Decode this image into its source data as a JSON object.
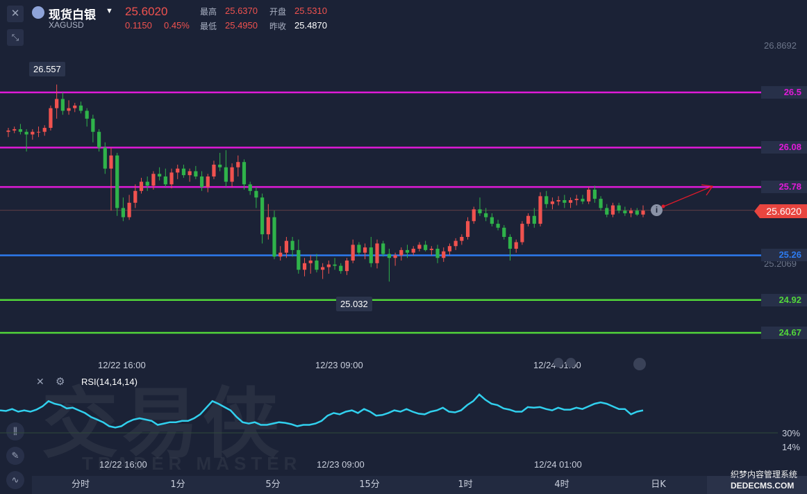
{
  "header": {
    "close_icon": "close-icon",
    "collapse_icon": "collapse-icon",
    "instrument_name": "现货白银",
    "symbol": "XAGUSD",
    "last_price": "25.6020",
    "change": "0.1150",
    "change_pct": "0.45%",
    "high_label": "最高",
    "high_value": "25.6370",
    "open_label": "开盘",
    "open_value": "25.5310",
    "low_label": "最低",
    "low_value": "25.4950",
    "prev_close_label": "昨收",
    "prev_close_value": "25.4870"
  },
  "colors": {
    "up": "#f0524f",
    "down": "#2fb34a",
    "magenta_level": "#e01ad8",
    "blue_level": "#2d7bf0",
    "green_level": "#52d63a",
    "rsi_line": "#31d0ee"
  },
  "price_axis": {
    "top_label": "26.8692",
    "mid_label": "25.2069",
    "current_price_tag": "25.6020"
  },
  "callouts": {
    "high": "26.557",
    "low": "25.032"
  },
  "levels": [
    {
      "value": 26.5,
      "label": "26.5",
      "color": "#e01ad8"
    },
    {
      "value": 26.08,
      "label": "26.08",
      "color": "#e01ad8"
    },
    {
      "value": 25.78,
      "label": "25.78",
      "color": "#e01ad8"
    },
    {
      "value": 25.26,
      "label": "25.26",
      "color": "#2d7bf0"
    },
    {
      "value": 24.92,
      "label": "24.92",
      "color": "#52d63a"
    },
    {
      "value": 24.67,
      "label": "24.67",
      "color": "#52d63a"
    }
  ],
  "time_labels": [
    "12/22 16:00",
    "12/23 09:00",
    "12/24 01:00"
  ],
  "rsi": {
    "label": "RSI(14,14,14)",
    "level_high": "30%",
    "level_low": "14%"
  },
  "tabs": [
    "分时",
    "1分",
    "5分",
    "15分",
    "1时",
    "4时",
    "日K"
  ],
  "watermark": {
    "logo": "交易侠",
    "brand": "TRADER MASTER",
    "corner": "织梦内容管理系统",
    "corner_url": "DEDECMS.COM"
  },
  "chart_data": {
    "type": "candlestick",
    "title": "现货白银 XAGUSD",
    "ylim": [
      24.45,
      26.95
    ],
    "x_ticks": [
      "12/22 16:00",
      "12/23 09:00",
      "12/24 01:00"
    ],
    "candles": [
      [
        26.2,
        26.23,
        26.16,
        26.21
      ],
      [
        26.21,
        26.24,
        26.19,
        26.22
      ],
      [
        26.22,
        26.26,
        26.18,
        26.2
      ],
      [
        26.2,
        26.22,
        26.05,
        26.18
      ],
      [
        26.18,
        26.22,
        26.14,
        26.2
      ],
      [
        26.2,
        26.24,
        26.16,
        26.2
      ],
      [
        26.2,
        26.25,
        26.17,
        26.23
      ],
      [
        26.23,
        26.4,
        26.21,
        26.38
      ],
      [
        26.38,
        26.56,
        26.3,
        26.45
      ],
      [
        26.45,
        26.5,
        26.33,
        26.36
      ],
      [
        26.36,
        26.44,
        26.33,
        26.38
      ],
      [
        26.38,
        26.42,
        26.35,
        26.4
      ],
      [
        26.4,
        26.43,
        26.34,
        26.36
      ],
      [
        26.36,
        26.38,
        26.24,
        26.3
      ],
      [
        26.3,
        26.33,
        26.12,
        26.2
      ],
      [
        26.2,
        26.22,
        26.05,
        26.08
      ],
      [
        26.08,
        26.12,
        25.88,
        25.92
      ],
      [
        25.92,
        26.08,
        25.6,
        26.02
      ],
      [
        26.02,
        26.04,
        25.56,
        25.62
      ],
      [
        25.62,
        25.7,
        25.52,
        25.55
      ],
      [
        25.55,
        25.72,
        25.53,
        25.66
      ],
      [
        25.66,
        25.8,
        25.62,
        25.75
      ],
      [
        25.75,
        25.85,
        25.73,
        25.82
      ],
      [
        25.82,
        25.86,
        25.75,
        25.79
      ],
      [
        25.79,
        25.9,
        25.76,
        25.88
      ],
      [
        25.88,
        25.93,
        25.83,
        25.86
      ],
      [
        25.86,
        25.92,
        25.78,
        25.8
      ],
      [
        25.8,
        25.92,
        25.77,
        25.89
      ],
      [
        25.89,
        25.95,
        25.84,
        25.92
      ],
      [
        25.92,
        25.95,
        25.85,
        25.87
      ],
      [
        25.87,
        25.92,
        25.82,
        25.9
      ],
      [
        25.9,
        25.94,
        25.84,
        25.86
      ],
      [
        25.86,
        25.9,
        25.75,
        25.78
      ],
      [
        25.78,
        25.88,
        25.74,
        25.86
      ],
      [
        25.86,
        25.98,
        25.84,
        25.95
      ],
      [
        25.95,
        26.04,
        25.9,
        25.93
      ],
      [
        25.93,
        26.06,
        25.78,
        25.82
      ],
      [
        25.82,
        25.96,
        25.78,
        25.93
      ],
      [
        25.93,
        26.02,
        25.86,
        25.97
      ],
      [
        25.97,
        25.99,
        25.76,
        25.8
      ],
      [
        25.8,
        25.82,
        25.72,
        25.75
      ],
      [
        25.75,
        25.78,
        25.62,
        25.7
      ],
      [
        25.7,
        25.73,
        25.35,
        25.42
      ],
      [
        25.42,
        25.65,
        25.38,
        25.55
      ],
      [
        25.55,
        25.6,
        25.23,
        25.25
      ],
      [
        25.25,
        25.33,
        25.22,
        25.28
      ],
      [
        25.28,
        25.4,
        25.24,
        25.37
      ],
      [
        25.37,
        25.4,
        25.25,
        25.3
      ],
      [
        25.3,
        25.38,
        25.12,
        25.15
      ],
      [
        25.15,
        25.24,
        25.1,
        25.2
      ],
      [
        25.2,
        25.26,
        25.12,
        25.22
      ],
      [
        25.22,
        25.27,
        25.13,
        25.15
      ],
      [
        25.15,
        25.2,
        25.08,
        25.17
      ],
      [
        25.17,
        25.22,
        25.12,
        25.19
      ],
      [
        25.19,
        25.24,
        25.15,
        25.18
      ],
      [
        25.18,
        25.2,
        25.12,
        25.14
      ],
      [
        25.14,
        25.24,
        25.11,
        25.22
      ],
      [
        25.22,
        25.38,
        25.2,
        25.34
      ],
      [
        25.34,
        25.36,
        25.26,
        25.28
      ],
      [
        25.28,
        25.35,
        25.23,
        25.32
      ],
      [
        25.32,
        25.4,
        25.17,
        25.2
      ],
      [
        25.2,
        25.38,
        25.16,
        25.35
      ],
      [
        25.35,
        25.37,
        25.25,
        25.27
      ],
      [
        25.27,
        25.31,
        25.06,
        25.24
      ],
      [
        25.24,
        25.28,
        25.18,
        25.26
      ],
      [
        25.26,
        25.32,
        25.22,
        25.3
      ],
      [
        25.3,
        25.34,
        25.24,
        25.28
      ],
      [
        25.28,
        25.33,
        25.26,
        25.31
      ],
      [
        25.31,
        25.36,
        25.29,
        25.34
      ],
      [
        25.34,
        25.37,
        25.29,
        25.3
      ],
      [
        25.3,
        25.33,
        25.26,
        25.31
      ],
      [
        25.31,
        25.34,
        25.2,
        25.24
      ],
      [
        25.24,
        25.32,
        25.21,
        25.29
      ],
      [
        25.29,
        25.35,
        25.26,
        25.33
      ],
      [
        25.33,
        25.39,
        25.3,
        25.37
      ],
      [
        25.37,
        25.42,
        25.34,
        25.4
      ],
      [
        25.4,
        25.55,
        25.38,
        25.52
      ],
      [
        25.52,
        25.63,
        25.5,
        25.61
      ],
      [
        25.61,
        25.7,
        25.56,
        25.58
      ],
      [
        25.58,
        25.62,
        25.52,
        25.55
      ],
      [
        25.55,
        25.58,
        25.48,
        25.5
      ],
      [
        25.5,
        25.53,
        25.45,
        25.47
      ],
      [
        25.47,
        25.49,
        25.38,
        25.4
      ],
      [
        25.4,
        25.42,
        25.22,
        25.31
      ],
      [
        25.31,
        25.38,
        25.28,
        25.36
      ],
      [
        25.36,
        25.52,
        25.34,
        25.5
      ],
      [
        25.5,
        25.58,
        25.48,
        25.56
      ],
      [
        25.56,
        25.62,
        25.47,
        25.5
      ],
      [
        25.5,
        25.74,
        25.48,
        25.71
      ],
      [
        25.71,
        25.75,
        25.62,
        25.65
      ],
      [
        25.65,
        25.7,
        25.61,
        25.67
      ],
      [
        25.67,
        25.71,
        25.64,
        25.68
      ],
      [
        25.68,
        25.72,
        25.62,
        25.66
      ],
      [
        25.66,
        25.7,
        25.62,
        25.68
      ],
      [
        25.68,
        25.72,
        25.64,
        25.69
      ],
      [
        25.69,
        25.72,
        25.65,
        25.67
      ],
      [
        25.67,
        25.78,
        25.65,
        25.76
      ],
      [
        25.76,
        25.79,
        25.66,
        25.69
      ],
      [
        25.69,
        25.71,
        25.6,
        25.62
      ],
      [
        25.62,
        25.65,
        25.55,
        25.57
      ],
      [
        25.57,
        25.66,
        25.55,
        25.64
      ],
      [
        25.64,
        25.66,
        25.58,
        25.6
      ],
      [
        25.6,
        25.63,
        25.56,
        25.58
      ],
      [
        25.58,
        25.62,
        25.55,
        25.6
      ],
      [
        25.6,
        25.62,
        25.56,
        25.57
      ],
      [
        25.57,
        25.64,
        25.55,
        25.6
      ]
    ],
    "rsi_values": [
      52,
      51,
      54,
      50,
      52,
      50,
      53,
      58,
      66,
      62,
      60,
      55,
      56,
      52,
      48,
      42,
      38,
      34,
      28,
      26,
      28,
      34,
      38,
      40,
      38,
      36,
      30,
      32,
      34,
      34,
      36,
      36,
      40,
      46,
      56,
      66,
      62,
      57,
      52,
      42,
      34,
      32,
      34,
      30,
      30,
      32,
      34,
      33,
      31,
      28,
      30,
      30,
      32,
      36,
      44,
      48,
      46,
      50,
      52,
      48,
      54,
      50,
      44,
      45,
      48,
      52,
      50,
      54,
      50,
      47,
      46,
      50,
      52,
      56,
      50,
      49,
      52,
      60,
      66,
      76,
      68,
      62,
      60,
      55,
      53,
      50,
      50,
      57,
      56,
      57,
      54,
      52,
      56,
      53,
      53,
      56,
      54,
      58,
      62,
      64,
      62,
      58,
      54,
      54,
      46,
      50,
      52
    ],
    "series": [
      {
        "name": "RSI(14,14,14)",
        "values_ref": "rsi_values"
      }
    ]
  }
}
